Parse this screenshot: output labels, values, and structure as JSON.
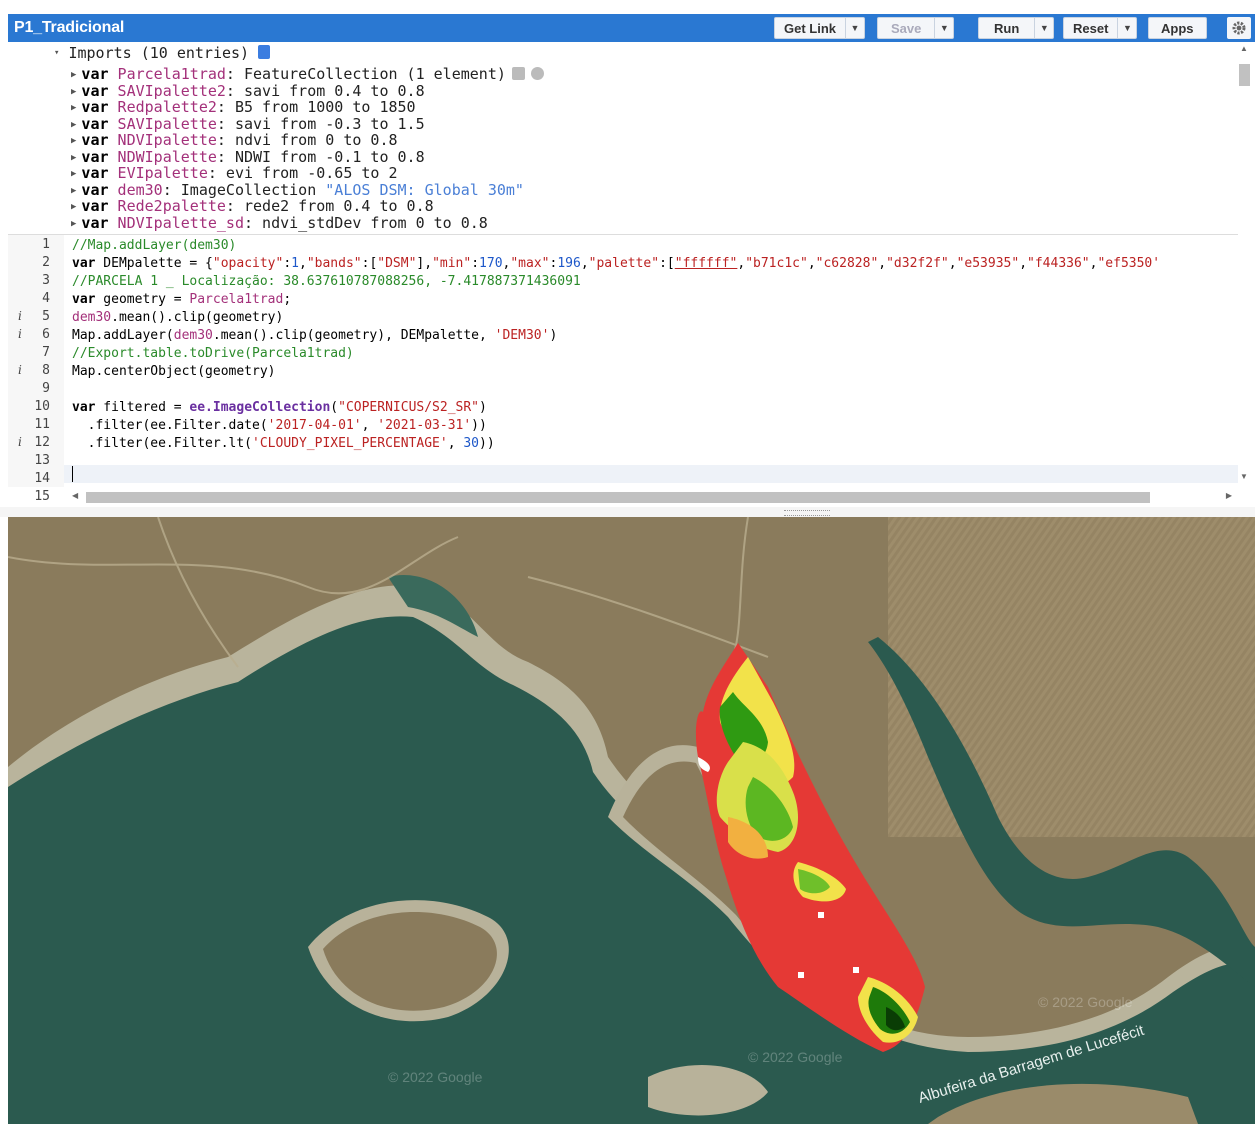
{
  "toolbar": {
    "script_name": "P1_Tradicional",
    "get_link": "Get Link",
    "save": "Save",
    "run": "Run",
    "reset": "Reset",
    "apps": "Apps"
  },
  "imports": {
    "header": "Imports (10 entries)",
    "entries": [
      {
        "name": "Parcela1trad",
        "desc": ": FeatureCollection (1 element)"
      },
      {
        "name": "SAVIpalette2",
        "desc": ": savi from 0.4 to 0.8"
      },
      {
        "name": "Redpalette2",
        "desc": ": B5 from 1000 to 1850"
      },
      {
        "name": "SAVIpalette",
        "desc": ": savi from -0.3 to 1.5"
      },
      {
        "name": "NDVIpalette",
        "desc": ": ndvi from 0 to 0.8"
      },
      {
        "name": "NDWIpalette",
        "desc": ": NDWI from -0.1 to 0.8"
      },
      {
        "name": "EVIpalette",
        "desc": ": evi from -0.65 to 2"
      },
      {
        "name": "dem30",
        "desc": ": ImageCollection ",
        "str": "\"ALOS DSM: Global 30m\""
      },
      {
        "name": "Rede2palette",
        "desc": ": rede2 from 0.4 to 0.8"
      },
      {
        "name": "NDVIpalette_sd",
        "desc": ": ndvi_stdDev from 0 to 0.8"
      }
    ]
  },
  "code": {
    "line_numbers": [
      "1",
      "2",
      "3",
      "4",
      "5",
      "6",
      "7",
      "8",
      "9",
      "10",
      "11",
      "12",
      "13",
      "14",
      "15"
    ],
    "info_markers": [
      "i",
      "i",
      "i",
      "i"
    ],
    "l1": "//Map.addLayer(dem30)",
    "l2_kw": "var",
    "l2_a": " DEMpalette = {",
    "l2_s1": "\"opacity\"",
    "l2_b": ":",
    "l2_n1": "1",
    "l2_c": ",",
    "l2_s2": "\"bands\"",
    "l2_d": ":[",
    "l2_s3": "\"DSM\"",
    "l2_e": "],",
    "l2_s4": "\"min\"",
    "l2_f": ":",
    "l2_n2": "170",
    "l2_g": ",",
    "l2_s5": "\"max\"",
    "l2_h": ":",
    "l2_n3": "196",
    "l2_i": ",",
    "l2_s6": "\"palette\"",
    "l2_j": ":[",
    "l2_p1": "\"ffffff\"",
    "l2_p2": "\"b71c1c\"",
    "l2_p3": "\"c62828\"",
    "l2_p4": "\"d32f2f\"",
    "l2_p5": "\"e53935\"",
    "l2_p6": "\"f44336\"",
    "l2_p7": "\"ef5350'",
    "l3": "//PARCELA 1 _ Localização: 38.637610787088256, -7.417887371436091",
    "l4_kw": "var",
    "l4_a": " geometry = ",
    "l4_v": "Parcela1trad",
    "l4_b": ";",
    "l5_v": "dem30",
    "l5_a": ".mean().clip(geometry)",
    "l6_a": "Map.addLayer(",
    "l6_v": "dem30",
    "l6_b": ".mean().clip(geometry), DEMpalette, ",
    "l6_s": "'DEM30'",
    "l6_c": ")",
    "l7": "//Export.table.toDrive(Parcela1trad)",
    "l8": "Map.centerObject(geometry)",
    "l10_kw": "var",
    "l10_a": " filtered = ",
    "l10_fn": "ee.ImageCollection",
    "l10_b": "(",
    "l10_s": "\"COPERNICUS/S2_SR\"",
    "l10_c": ")",
    "l11_a": "  .filter(ee.Filter.date(",
    "l11_s1": "'2017-04-01'",
    "l11_b": ", ",
    "l11_s2": "'2021-03-31'",
    "l11_c": "))",
    "l12_a": "  .filter(ee.Filter.lt(",
    "l12_s": "'CLOUDY_PIXEL_PERCENTAGE'",
    "l12_b": ", ",
    "l12_n": "30",
    "l12_c": "))"
  },
  "map": {
    "place_label": "Albufeira da Barragem de Lucefécit",
    "watermark": "© 2022 Google",
    "colors": {
      "water": "#2a5a4f",
      "land": "#8f8060",
      "shore": "#b8b29a",
      "low": "#e53935",
      "mid": "#f2e24a",
      "high": "#2f9a12"
    }
  }
}
